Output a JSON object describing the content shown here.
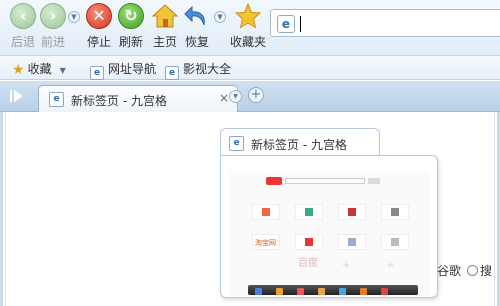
{
  "toolbar": {
    "back": "后退",
    "forward": "前进",
    "stop": "停止",
    "refresh": "刷新",
    "home": "主页",
    "restore": "恢复",
    "favorites": "收藏夹"
  },
  "address_bar": {
    "value": ""
  },
  "bookmarks_bar": {
    "favorites_menu": "收藏",
    "items": [
      {
        "label": "网址导航"
      },
      {
        "label": "影视大全"
      }
    ]
  },
  "tabs": [
    {
      "title": "新标签页 - 九宫格",
      "close": "×"
    }
  ],
  "new_tab_symbol": "+",
  "preview": {
    "title": "新标签页 - 九宫格",
    "thumb_tiles": [
      "淘宝网",
      "百度"
    ]
  },
  "background": {
    "radio_labels": [
      "谷歌",
      "搜"
    ]
  },
  "colors": {
    "accent": "#2f6fb5",
    "stop_red": "#d6321c",
    "refresh_green": "#3d9e1f",
    "star_gold": "#e3a21a"
  }
}
